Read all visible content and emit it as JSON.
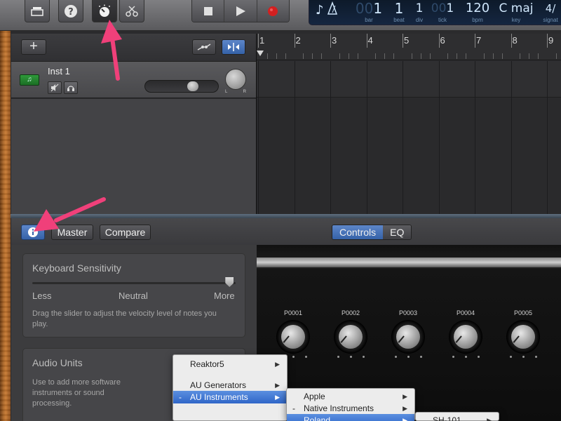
{
  "toolbar": {
    "buttons": [
      "library-icon",
      "help-icon",
      "smart-controls-icon",
      "editors-icon"
    ],
    "transport": [
      "stop-icon",
      "play-icon",
      "record-icon"
    ]
  },
  "lcd": {
    "bar": {
      "dim": "00",
      "value": "1",
      "label": "bar"
    },
    "beat": {
      "value": "1",
      "label": "beat"
    },
    "div": {
      "value": "1",
      "label": "div"
    },
    "tick": {
      "dim": "00",
      "value": "1",
      "label": "tick"
    },
    "bpm": {
      "value": "120",
      "label": "bpm"
    },
    "key": {
      "value": "C maj",
      "label": "key"
    },
    "signature": {
      "value": "4/",
      "label": "signat"
    }
  },
  "track": {
    "name": "Inst 1",
    "pan_l": "L",
    "pan_r": "R",
    "volume": 0.65
  },
  "ruler": {
    "bars": [
      "1",
      "2",
      "3",
      "4",
      "5",
      "6",
      "7",
      "8",
      "9"
    ]
  },
  "bottom": {
    "tabs": {
      "master": "Master",
      "compare": "Compare",
      "controls": "Controls",
      "eq": "EQ"
    },
    "keyboard": {
      "title": "Keyboard Sensitivity",
      "less": "Less",
      "neutral": "Neutral",
      "more": "More",
      "description": "Drag the slider to adjust the velocity level of notes you play.",
      "value": 0.97
    },
    "audio_units": {
      "title": "Audio Units",
      "description": "Use to add more software instruments or sound processing."
    }
  },
  "plugin": {
    "knobs": [
      "P0001",
      "P0002",
      "P0003",
      "P0004",
      "P0005"
    ]
  },
  "menus": {
    "level1": [
      {
        "label": "Reaktor5",
        "arrow": "▶"
      },
      {
        "label": "AU Generators",
        "arrow": "▶"
      },
      {
        "label": "AU Instruments",
        "arrow": "▶",
        "dash": "-"
      }
    ],
    "level2": [
      {
        "label": "Apple",
        "arrow": "▶"
      },
      {
        "label": "Native Instruments",
        "arrow": "▶",
        "dash": "-"
      },
      {
        "label": "Roland",
        "arrow": "▶"
      }
    ],
    "level3": [
      {
        "label": "SH-101",
        "arrow": "▶"
      }
    ]
  },
  "colors": {
    "accent": "#3562a8",
    "annotation": "#f0407a"
  }
}
